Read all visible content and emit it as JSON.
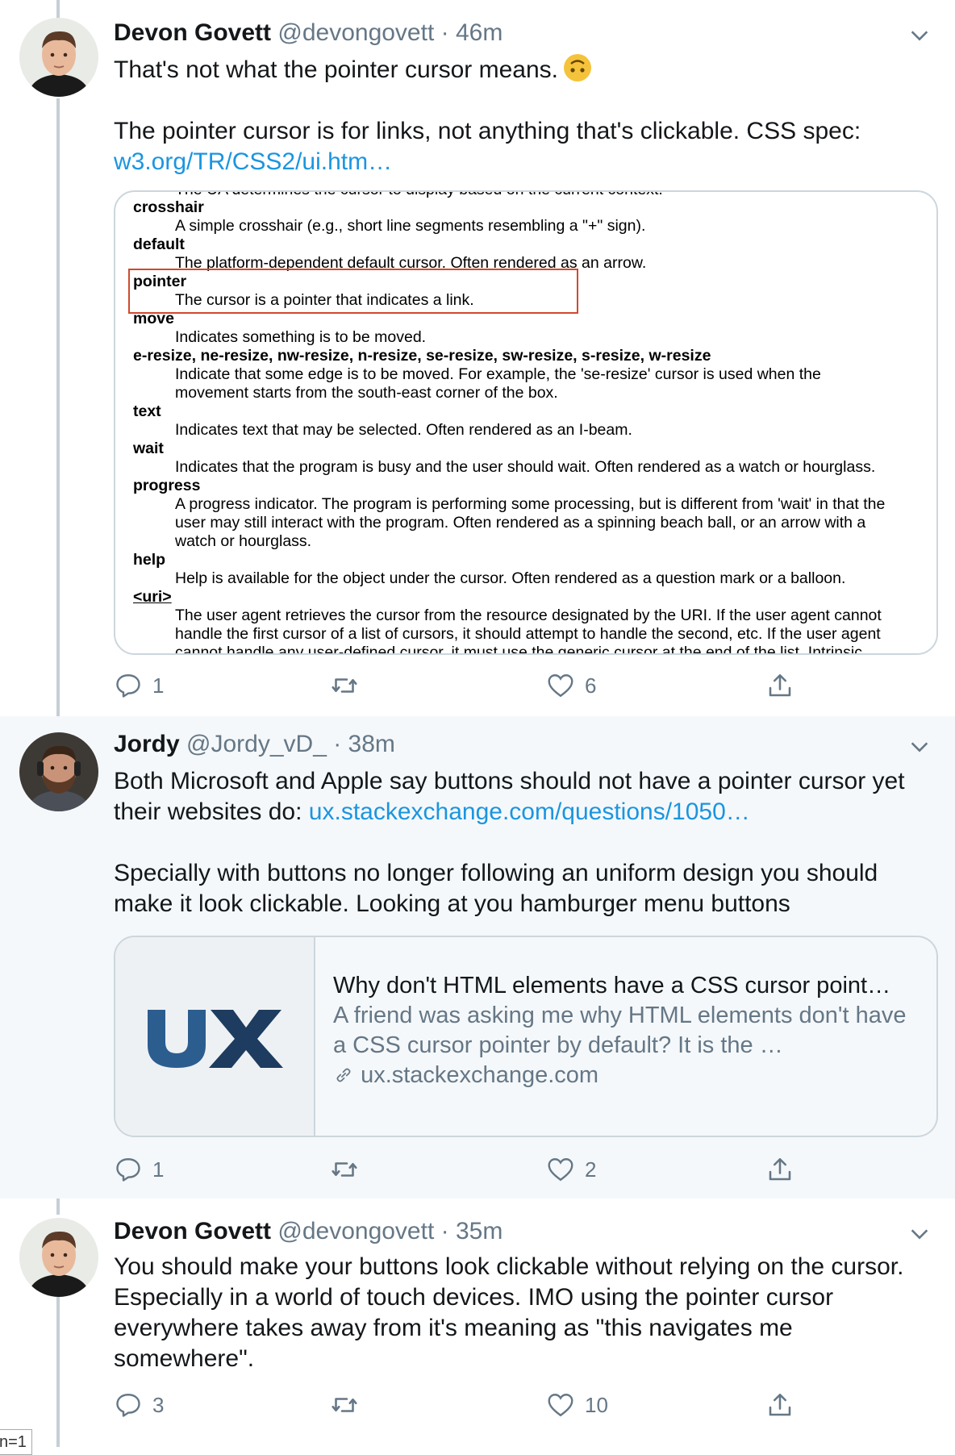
{
  "tweets": [
    {
      "name": "Devon Govett",
      "meta": "@devongovett · 46m",
      "text_line1": "That's not what the pointer cursor means.",
      "emoji": "upside-down-face",
      "text_para2": "The pointer cursor is for links, not anything that's clickable. CSS spec:",
      "link": "w3.org/TR/CSS2/ui.htm…",
      "reply_count": "1",
      "retweet_count": "",
      "like_count": "6"
    },
    {
      "name": "Jordy",
      "meta": "@Jordy_vD_ · 38m",
      "text_line1": "Both Microsoft and Apple say buttons should not have a pointer cursor yet",
      "text_line2_prefix": "their websites do: ",
      "link": "ux.stackexchange.com/questions/1050…",
      "text_para2": "Specially with buttons no longer following an uniform design you should make it look clickable. Looking at you hamburger menu buttons",
      "reply_count": "1",
      "retweet_count": "",
      "like_count": "2"
    },
    {
      "name": "Devon Govett",
      "meta": "@devongovett · 35m",
      "text": "You should make your buttons look clickable without relying on the cursor. Especially in a world of touch devices. IMO using the pointer cursor everywhere takes away from it's meaning as \"this navigates me somewhere\".",
      "reply_count": "3",
      "retweet_count": "",
      "like_count": "10"
    }
  ],
  "spec_screenshot": {
    "top_cut": "The UA determines the cursor to display based on the current context.",
    "rows": [
      {
        "term": "crosshair",
        "def": "A simple crosshair (e.g., short line segments resembling a \"+\" sign)."
      },
      {
        "term": "default",
        "def": "The platform-dependent default cursor. Often rendered as an arrow."
      },
      {
        "term": "pointer",
        "def": "The cursor is a pointer that indicates a link."
      },
      {
        "term": "move",
        "def": "Indicates something is to be moved."
      },
      {
        "term": "e-resize, ne-resize, nw-resize, n-resize, se-resize, sw-resize, s-resize, w-resize",
        "def": "Indicate that some edge is to be moved. For example, the 'se-resize' cursor is used when the",
        "def2": "movement starts from the south-east corner of the box."
      },
      {
        "term": "text",
        "def": "Indicates text that may be selected. Often rendered as an I-beam."
      },
      {
        "term": "wait",
        "def": "Indicates that the program is busy and the user should wait. Often rendered as a watch or hourglass."
      },
      {
        "term": "progress",
        "def": "A progress indicator. The program is performing some processing, but is different from 'wait' in that the",
        "def2": "user may still interact with the program. Often rendered as a spinning beach ball, or an arrow with a",
        "def3": "watch or hourglass."
      },
      {
        "term": "help",
        "def": "Help is available for the object under the cursor. Often rendered as a question mark or a balloon."
      },
      {
        "term": "<uri>",
        "def": "The user agent retrieves the cursor from the resource designated by the URI. If the user agent cannot",
        "def2": "handle the first cursor of a list of cursors, it should attempt to handle the second, etc. If the user agent",
        "def3": "cannot handle any user-defined cursor, it must use the generic cursor at the end of the list. Intrinsic"
      }
    ],
    "highlight_color": "#d0492e"
  },
  "link_card": {
    "logo_text": "UX",
    "logo_colors": {
      "u": "#2c5d8f",
      "x": "#1d3c5f"
    },
    "title": "Why don't HTML elements have a CSS cursor point…",
    "description": "A friend was asking me why HTML elements don't have a CSS cursor pointer by default? It is the …",
    "domain": "ux.stackexchange.com"
  },
  "colors": {
    "link": "#1b95e0",
    "secondary_text": "#657786",
    "thread_line": "#c4cfd6",
    "shaded_bg": "#f5f8fa"
  },
  "corner_label": "n=1"
}
